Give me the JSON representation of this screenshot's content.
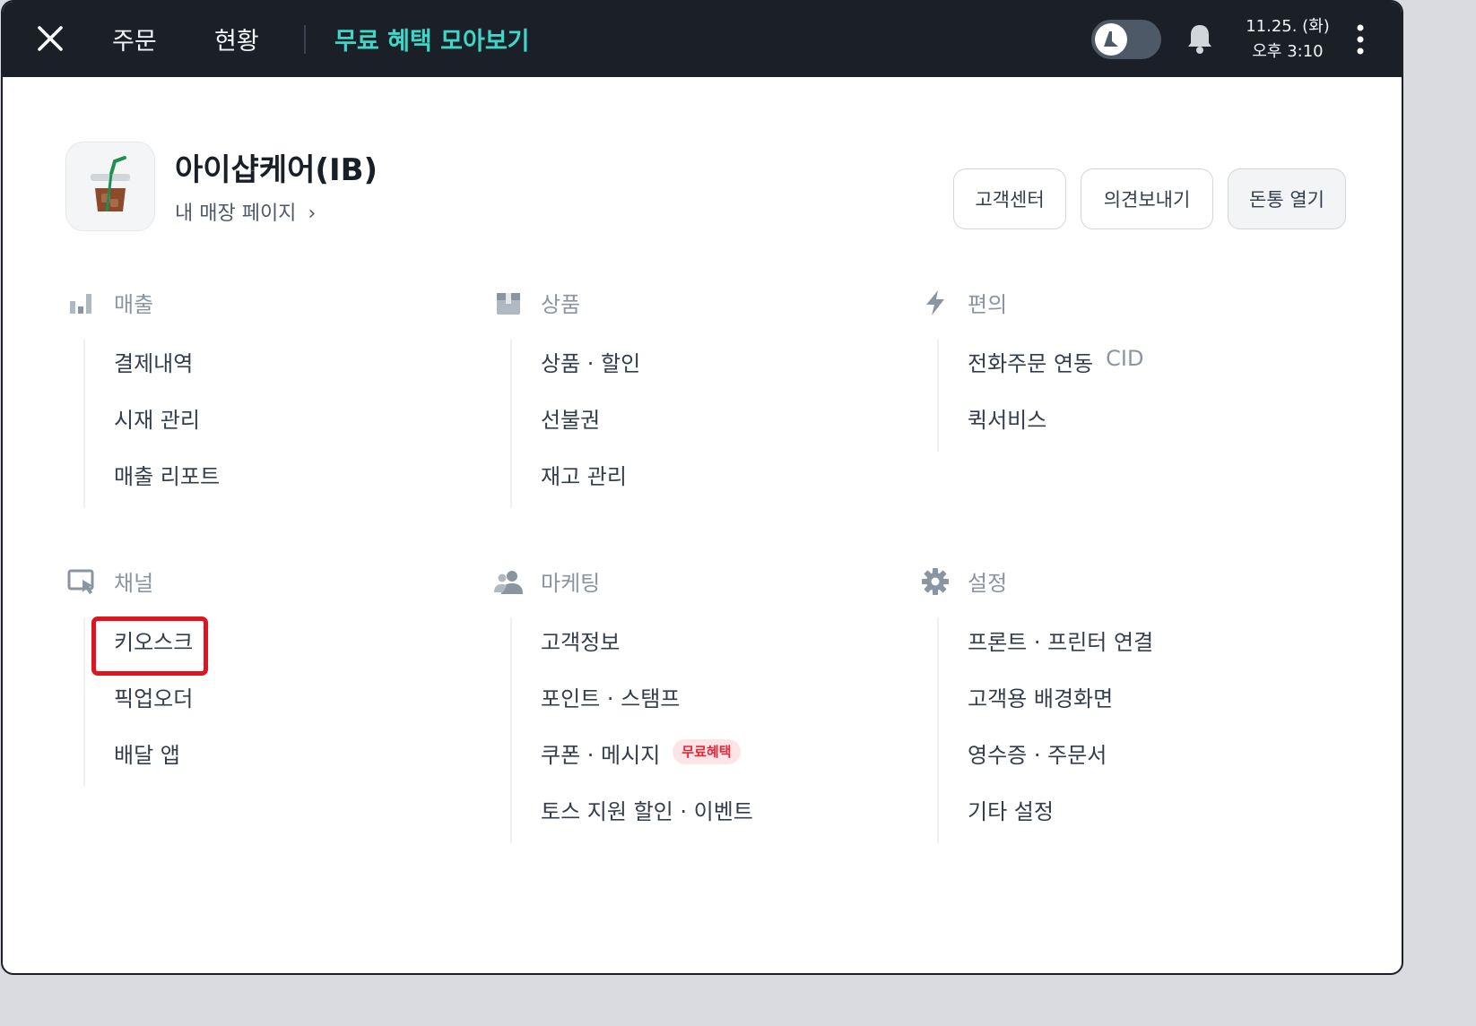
{
  "topbar": {
    "tabs": [
      "주문",
      "현황"
    ],
    "promo": "무료 혜택 모아보기",
    "date": "11.25. (화)",
    "time": "오후 3:10"
  },
  "store": {
    "name": "아이샵케어(IB)",
    "link": "내 매장 페이지"
  },
  "header_buttons": [
    "고객센터",
    "의견보내기",
    "돈통 열기"
  ],
  "sections": {
    "sales": {
      "title": "매출",
      "icon": "bar-chart-icon",
      "items": [
        "결제내역",
        "시재 관리",
        "매출 리포트"
      ]
    },
    "products": {
      "title": "상품",
      "icon": "box-icon",
      "items": [
        "상품 · 할인",
        "선불권",
        "재고 관리"
      ]
    },
    "convenience": {
      "title": "편의",
      "icon": "lightning-icon",
      "items": [
        "전화주문 연동",
        "퀵서비스"
      ],
      "cid_label": "CID"
    },
    "channel": {
      "title": "채널",
      "icon": "kiosk-touch-icon",
      "items": [
        "키오스크",
        "픽업오더",
        "배달 앱"
      ]
    },
    "marketing": {
      "title": "마케팅",
      "icon": "people-icon",
      "items": [
        "고객정보",
        "포인트 · 스탬프",
        "쿠폰 · 메시지",
        "토스 지원 할인 · 이벤트"
      ],
      "badge": "무료혜택"
    },
    "settings": {
      "title": "설정",
      "icon": "gear-icon",
      "items": [
        "프론트 · 프린터 연결",
        "고객용 배경화면",
        "영수증 · 주문서",
        "기타 설정"
      ]
    }
  },
  "colors": {
    "topbar": "#1b1f27",
    "promo": "#3fd6c7",
    "highlight": "#e0141e",
    "badge_bg": "#fde4e6",
    "badge_text": "#e42939"
  }
}
